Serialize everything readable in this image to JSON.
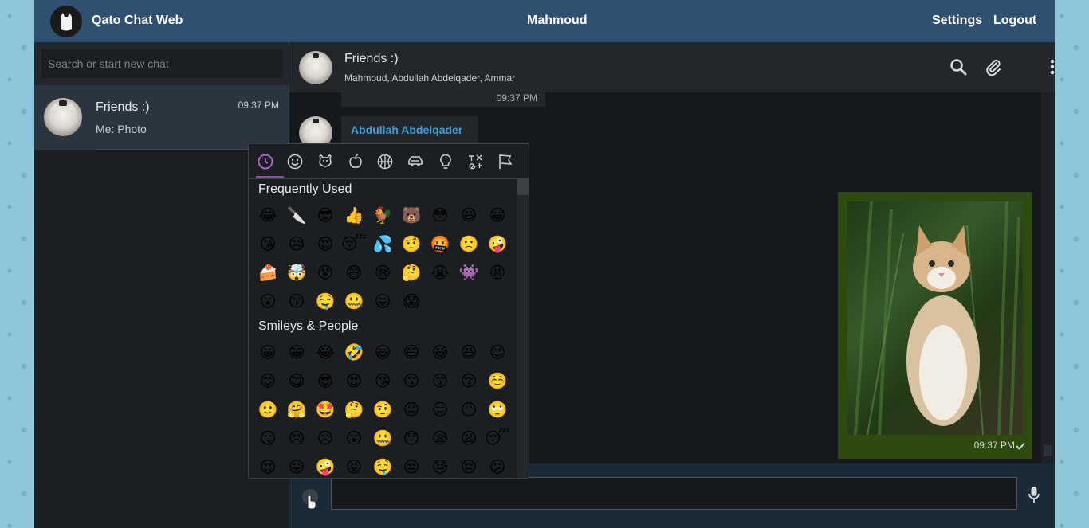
{
  "app": {
    "title": "Qato Chat Web",
    "logo_icon": "cat-logo-icon"
  },
  "header": {
    "current_user": "Mahmoud",
    "settings_label": "Settings",
    "logout_label": "Logout"
  },
  "sidebar": {
    "search_placeholder": "Search or start new chat",
    "chats": [
      {
        "name": "Friends :)",
        "time": "09:37 PM",
        "preview": "Me: Photo"
      }
    ]
  },
  "chat": {
    "title": "Friends :)",
    "members": "Mahmoud, Abdullah Abdelqader, Ammar",
    "icons": [
      "search-icon",
      "paperclip-icon",
      "more-vertical-icon"
    ],
    "messages": {
      "prev_time": "09:37 PM",
      "sender": "Abdullah Abdelqader",
      "photo_time": "09:37 PM"
    }
  },
  "emoji_picker": {
    "tabs": [
      "recent-icon",
      "smiley-icon",
      "animal-icon",
      "food-icon",
      "sports-icon",
      "travel-icon",
      "objects-icon",
      "symbols-icon",
      "flags-icon"
    ],
    "categories": [
      {
        "title": "Frequently Used",
        "emojis": [
          "😂",
          "🔪",
          "😎",
          "👍",
          "🐓",
          "🐻",
          "😳",
          "😆",
          "😀",
          "😘",
          "😥",
          "😍",
          "😴",
          "💦",
          "🤨",
          "🤬",
          "🙁",
          "🤪",
          "🍰",
          "🤯",
          "😵",
          "😅",
          "😪",
          "🤔",
          "😭",
          "👾",
          "😫",
          "😮",
          "😗",
          "🤤",
          "🤐",
          "😛",
          "😱"
        ]
      },
      {
        "title": "Smileys & People",
        "emojis": [
          "😀",
          "😁",
          "😂",
          "🤣",
          "😃",
          "😄",
          "😅",
          "😆",
          "😉",
          "😊",
          "😋",
          "😎",
          "😍",
          "😘",
          "😗",
          "😙",
          "😚",
          "☺️",
          "🙂",
          "🤗",
          "🤩",
          "🤔",
          "🤨",
          "😐",
          "😑",
          "😶",
          "🙄",
          "😏",
          "😣",
          "😥",
          "😮",
          "🤐",
          "😯",
          "😪",
          "😫",
          "😴",
          "😌",
          "😛",
          "🤪",
          "😝",
          "🤤",
          "😒",
          "😓",
          "😔",
          "😕"
        ]
      }
    ]
  },
  "colors": {
    "topbar": "#2f5070",
    "accent_tab": "#8e4bb5",
    "outgoing_bubble": "#2f4a0e",
    "sender_name": "#3b9fe0"
  }
}
